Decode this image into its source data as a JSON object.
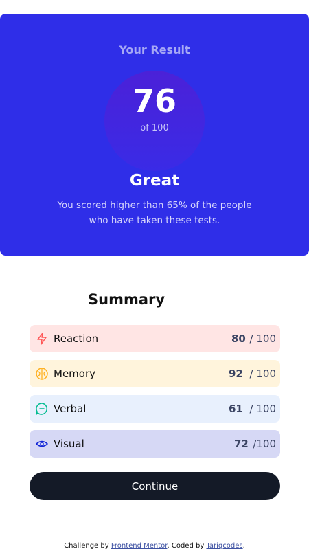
{
  "result": {
    "heading": "Your Result",
    "score": "76",
    "of_label": "of 100",
    "grade": "Great",
    "description": "You scored higher than 65% of the people who have taken these tests."
  },
  "summary": {
    "title": "Summary",
    "items": [
      {
        "label": "Reaction",
        "score": "80",
        "max": "/ 100",
        "icon": "lightning-icon",
        "bg": "#ffe5e4",
        "accent": "#ff5757"
      },
      {
        "label": "Memory",
        "score": "92",
        "max": "/ 100",
        "icon": "brain-icon",
        "bg": "#fff4dc",
        "accent": "#ffb01f"
      },
      {
        "label": "Verbal",
        "score": "61",
        "max": "/ 100",
        "icon": "chat-bubble-icon",
        "bg": "#e8f0fd",
        "accent": "#00bb8f"
      },
      {
        "label": "Visual",
        "score": "72",
        "max": "/100",
        "icon": "eye-icon",
        "bg": "#d6d8f5",
        "accent": "#1125d6"
      }
    ]
  },
  "continue_label": "Continue",
  "attribution": {
    "prefix": "Challenge by ",
    "link1": "Frontend Mentor",
    "middle": ". Coded by ",
    "link2": "Tariqcodes",
    "suffix": "."
  },
  "colors": {
    "card_bg": "#2f2ee8",
    "button_bg": "#141a27"
  }
}
